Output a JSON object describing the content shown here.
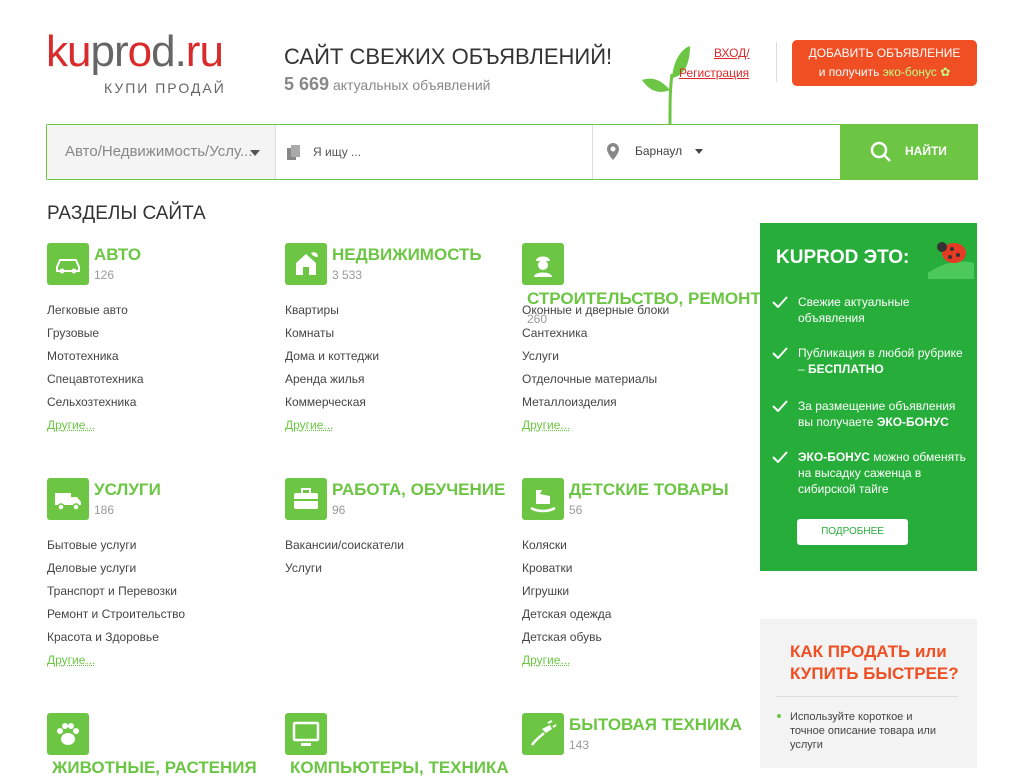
{
  "header": {
    "logo_red_1": "ku",
    "logo_grey_1": "pr",
    "logo_red_2": "o",
    "logo_grey_2": "d.",
    "logo_red_3": "ru",
    "logo_tagline": "КУПИ ПРОДАЙ",
    "site_title": "САЙТ СВЕЖИХ ОБЪЯВЛЕНИЙ!",
    "ads_count": "5 669",
    "ads_count_label": "актуальных объявлений",
    "login_label": "ВХОД/",
    "register_label": "Регистрация",
    "add_button_line1": "ДОБАВИТЬ ОБЪЯВЛЕНИЕ",
    "add_button_line2": "и получить",
    "add_button_eco": "эко-бонус"
  },
  "search": {
    "category_value": "Авто/Недвижимость/Услу...",
    "query_placeholder": "Я ищу ...",
    "city_value": "Барнаул",
    "find_label": "НАЙТИ"
  },
  "sections": {
    "heading": "РАЗДЕЛЫ САЙТА",
    "more_label": "Другие...",
    "categories": [
      {
        "title": "АВТО",
        "count": "126",
        "links": [
          "Легковые авто",
          "Грузовые",
          "Мототехника",
          "Спецавтотехника",
          "Сельхозтехника"
        ]
      },
      {
        "title": "НЕДВИЖИМОСТЬ",
        "count": "3 533",
        "links": [
          "Квартиры",
          "Комнаты",
          "Дома и коттеджи",
          "Аренда жилья",
          "Коммерческая"
        ]
      },
      {
        "title": "СТРОИТЕЛЬСТВО, РЕМОНТ",
        "count": "260",
        "links": [
          "Оконные и дверные блоки",
          "Сантехника",
          "Услуги",
          "Отделочные материалы",
          "Металлоизделия"
        ]
      },
      {
        "title": "УСЛУГИ",
        "count": "186",
        "links": [
          "Бытовые услуги",
          "Деловые услуги",
          "Транспорт и Перевозки",
          "Ремонт и Строительство",
          "Красота и Здоровье"
        ]
      },
      {
        "title": "РАБОТА, ОБУЧЕНИЕ",
        "count": "96",
        "links": [
          "Вакансии/соискатели",
          "Услуги"
        ]
      },
      {
        "title": "ДЕТСКИЕ ТОВАРЫ",
        "count": "56",
        "links": [
          "Коляски",
          "Кроватки",
          "Игрушки",
          "Детская одежда",
          "Детская обувь"
        ]
      },
      {
        "title": "ЖИВОТНЫЕ, РАСТЕНИЯ",
        "count": "",
        "links": []
      },
      {
        "title": "КОМПЬЮТЕРЫ, ТЕХНИКА",
        "count": "",
        "links": []
      },
      {
        "title": "БЫТОВАЯ ТЕХНИКА",
        "count": "143",
        "links": []
      }
    ]
  },
  "promo": {
    "title": "KUPROD ЭТО:",
    "items": [
      {
        "text": "Свежие актуальные объявления",
        "bold": ""
      },
      {
        "text": "Публикация в любой рубрике – ",
        "bold": "БЕСПЛАТНО"
      },
      {
        "text": "За размещение объявления вы получаете ",
        "bold": "ЭКО-БОНУС"
      },
      {
        "bold_first": "ЭКО-БОНУС",
        "text": " можно обменять на высадку саженца в сибирской тайге"
      }
    ],
    "button_label": "ПОДРОБНЕЕ"
  },
  "howto": {
    "title": "КАК ПРОДАТЬ или КУПИТЬ БЫСТРЕЕ?",
    "item": "Используйте короткое и точное описание товара или услуги"
  },
  "colors": {
    "brand_green": "#6cc644",
    "brand_red": "#d92b2b",
    "accent_orange": "#f04e23",
    "promo_green": "#27ae3a"
  },
  "icons": {
    "auto": "car-icon",
    "realty": "house-icon",
    "build": "worker-icon",
    "services": "truck-icon",
    "jobs": "briefcase-icon",
    "kids": "rocking-horse-icon",
    "pets": "paw-icon",
    "computers": "monitor-icon",
    "appliances": "plug-icon"
  }
}
